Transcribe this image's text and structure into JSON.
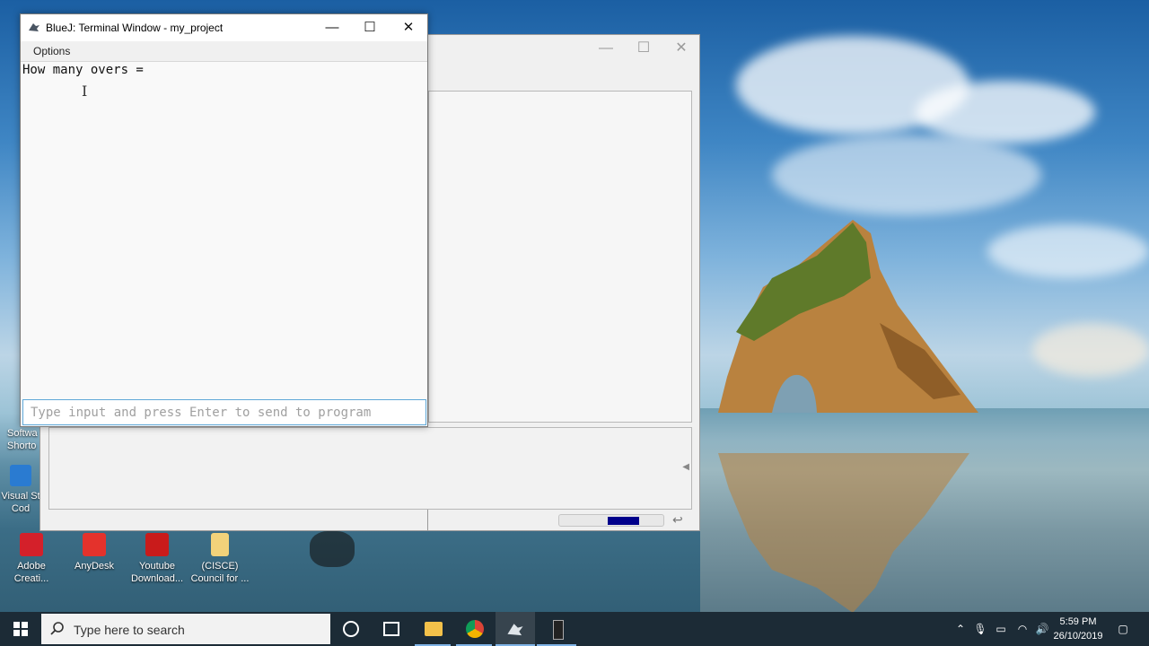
{
  "terminal_window": {
    "title": "BlueJ: Terminal Window - my_project",
    "menu": {
      "options": "Options"
    },
    "output_text": "How many overs =",
    "input_placeholder": "Type input and press Enter to send to program",
    "controls": {
      "minimize": "—",
      "maximize": "☐",
      "close": "✕"
    }
  },
  "main_window": {
    "controls": {
      "minimize": "—",
      "maximize": "☐",
      "close": "✕"
    },
    "progress_fraction": 0.3,
    "scroll_arrow": "◀"
  },
  "desktop_icons": [
    {
      "label": "Adobe Creati...",
      "icon": "adobe-creative-cloud-icon",
      "color": "#d4202a"
    },
    {
      "label": "AnyDesk",
      "icon": "anydesk-icon",
      "color": "#e4322c"
    },
    {
      "label": "Youtube Download...",
      "icon": "youtube-downloader-icon",
      "color": "#c91b1b"
    },
    {
      "label": "(CISCE) Council for ...",
      "icon": "folder-icon",
      "color": "#f2d27a"
    }
  ],
  "left_icon_texts": [
    "Softwa Shorto",
    "Visual St Cod"
  ],
  "taskbar": {
    "search_placeholder": "Type here to search",
    "time": "5:59 PM",
    "date": "26/10/2019"
  },
  "colors": {
    "taskbar": "#1c2b36",
    "progress_fill": "#00008b",
    "input_border": "#5fa8d8"
  }
}
